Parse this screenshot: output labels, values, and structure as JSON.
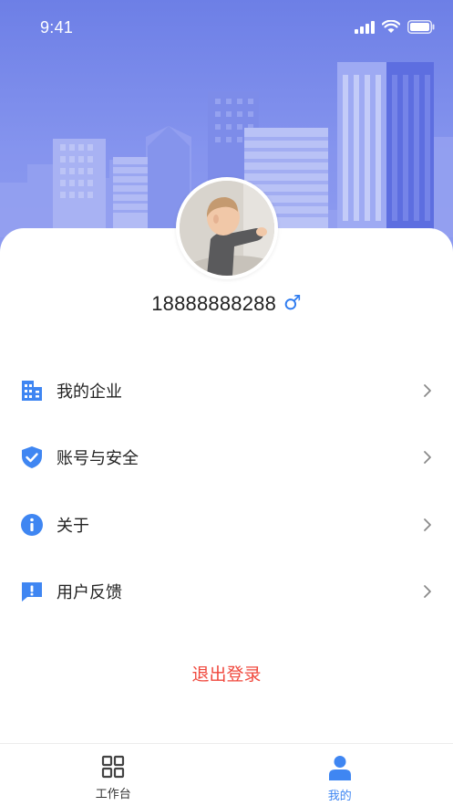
{
  "status_bar": {
    "time": "9:41"
  },
  "profile": {
    "phone": "18888888288",
    "gender_symbol": "♂"
  },
  "menu": [
    {
      "label": "我的企业",
      "icon": "building-icon"
    },
    {
      "label": "账号与安全",
      "icon": "shield-check-icon"
    },
    {
      "label": "关于",
      "icon": "info-icon"
    },
    {
      "label": "用户反馈",
      "icon": "feedback-icon"
    }
  ],
  "logout_label": "退出登录",
  "tabbar": {
    "tabs": [
      {
        "label": "工作台",
        "icon": "grid-icon",
        "active": false
      },
      {
        "label": "我的",
        "icon": "person-icon",
        "active": true
      }
    ]
  },
  "colors": {
    "accent": "#3f86f2",
    "logout": "#f0473c",
    "hero": "#7b8ceb"
  }
}
